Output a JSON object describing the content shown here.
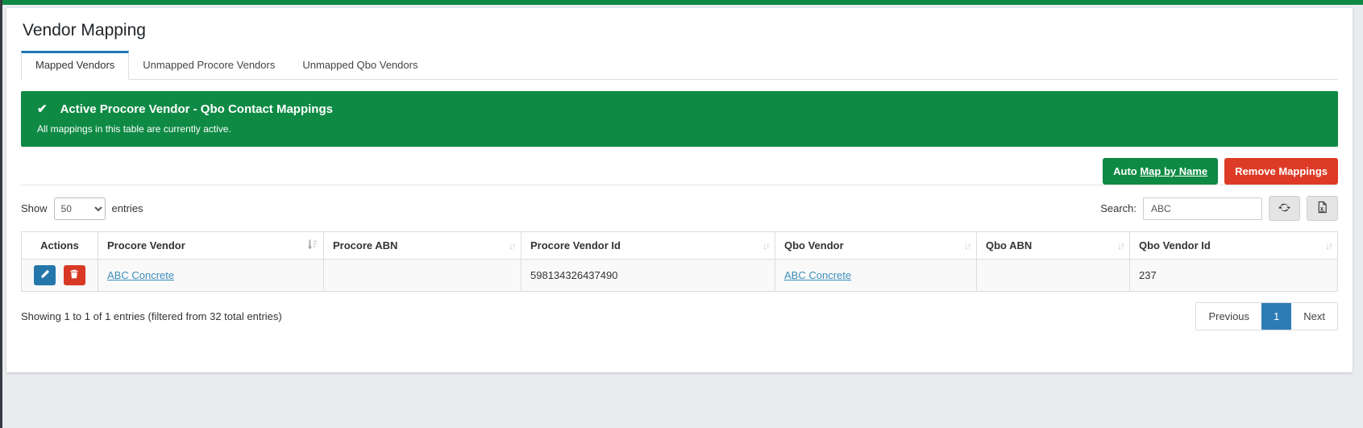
{
  "page": {
    "title": "Vendor Mapping"
  },
  "tabs": [
    {
      "label": "Mapped Vendors",
      "active": true
    },
    {
      "label": "Unmapped Procore Vendors",
      "active": false
    },
    {
      "label": "Unmapped Qbo Vendors",
      "active": false
    }
  ],
  "alert": {
    "icon": "check-icon",
    "title": "Active Procore Vendor - Qbo Contact Mappings",
    "message": "All mappings in this table are currently active."
  },
  "toolbar": {
    "auto_map_prefix": "Auto ",
    "auto_map_emphasis": "Map by Name",
    "remove_label": "Remove Mappings"
  },
  "controls": {
    "show_label": "Show",
    "page_length": "50",
    "entries_label": "entries",
    "search_label": "Search:",
    "search_value": "ABC",
    "refresh_icon": "refresh-icon",
    "export_icon": "excel-export-icon"
  },
  "table": {
    "columns": [
      {
        "label": "Actions",
        "sortable": false
      },
      {
        "label": "Procore Vendor",
        "sorted": true
      },
      {
        "label": "Procore ABN",
        "sorted": false
      },
      {
        "label": "Procore Vendor Id",
        "sorted": false
      },
      {
        "label": "Qbo Vendor",
        "sorted": false
      },
      {
        "label": "Qbo ABN",
        "sorted": false
      },
      {
        "label": "Qbo Vendor Id",
        "sorted": false
      }
    ],
    "rows": [
      {
        "procore_vendor": "ABC Concrete",
        "procore_abn": "",
        "procore_vendor_id": "598134326437490",
        "qbo_vendor": "ABC Concrete",
        "qbo_abn": "",
        "qbo_vendor_id": "237"
      }
    ],
    "sort_glyphs": "↓↑"
  },
  "footer": {
    "summary": "Showing 1 to 1 of 1 entries (filtered from 32 total entries)",
    "pagination": {
      "previous": "Previous",
      "page": "1",
      "next": "Next"
    }
  },
  "colors": {
    "accent_green": "#0e8a44",
    "danger_red": "#dd3b26",
    "link_blue": "#3c8dbc",
    "tab_active_border": "#2077b2",
    "edit_button_blue": "#2577ab",
    "delete_button_red": "#d73925",
    "pagination_active_blue": "#2e7cb5",
    "check_glyph": "✔"
  }
}
